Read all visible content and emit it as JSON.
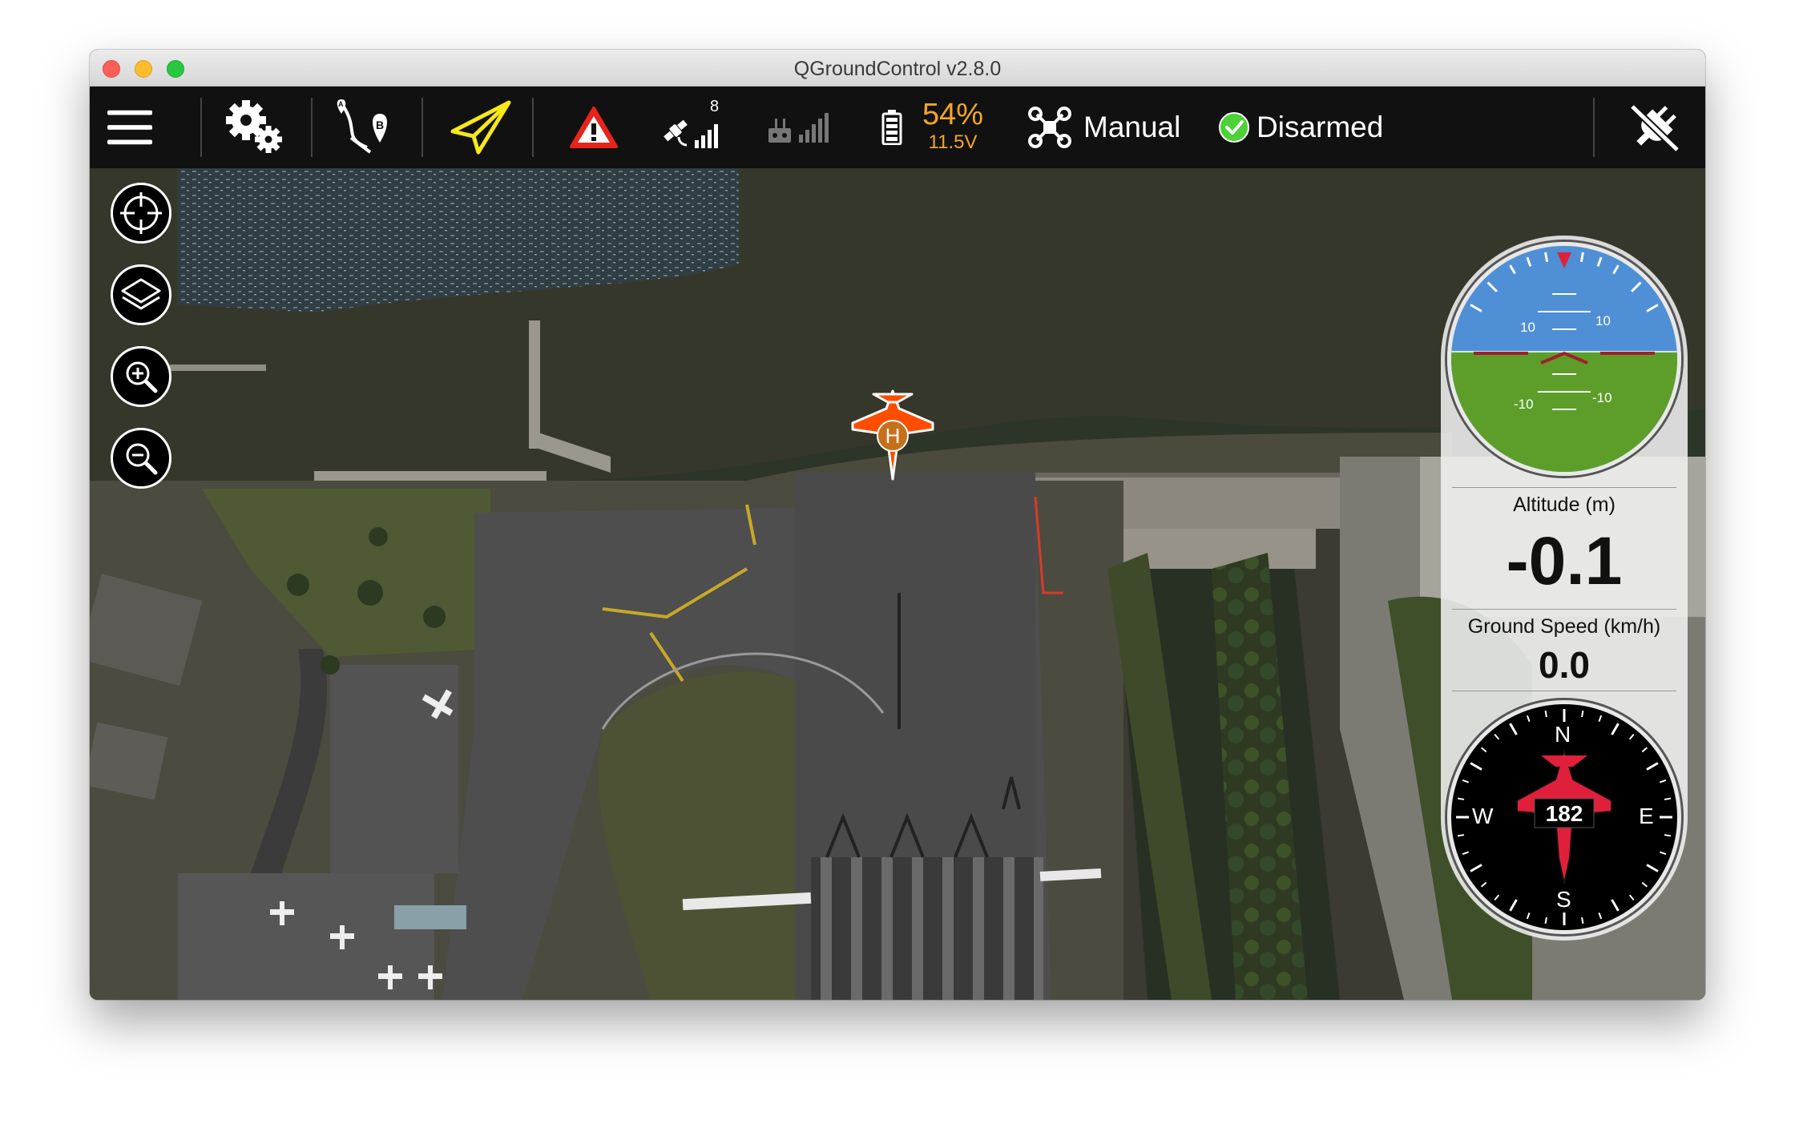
{
  "window": {
    "title": "QGroundControl v2.8.0"
  },
  "toolbar": {
    "satellite_count": "8",
    "battery_percent": "54%",
    "battery_voltage": "11.5V",
    "flight_mode": "Manual",
    "arm_status": "Disarmed"
  },
  "colors": {
    "battery": "#f5a623",
    "vehicle": "#ff4d00",
    "plan_yellow": "#f7e81b",
    "warning_red": "#e8231c",
    "armed_green": "#4cd137"
  },
  "instruments": {
    "altitude_label": "Altitude (m)",
    "altitude_value": "-0.1",
    "speed_label": "Ground Speed (km/h)",
    "speed_value": "0.0",
    "heading_value": "182",
    "compass_n": "N",
    "compass_e": "E",
    "compass_s": "S",
    "compass_w": "W",
    "pitch_up_left": "10",
    "pitch_up_right": "10",
    "pitch_down_left": "-10",
    "pitch_down_right": "-10"
  },
  "map": {
    "home_label": "H"
  },
  "icons": {
    "menu": "menu-icon",
    "settings": "gear-icon",
    "plan": "route-ab-icon",
    "fly": "paper-plane-icon",
    "warning": "warning-icon",
    "gps": "satellite-icon",
    "rc": "rc-signal-icon",
    "battery": "battery-icon",
    "mode": "quadcopter-icon",
    "armed": "check-circle-icon",
    "disconnect": "plug-disconnect-icon",
    "center": "crosshair-icon",
    "layers": "layers-icon",
    "zoom_in": "zoom-in-icon",
    "zoom_out": "zoom-out-icon"
  }
}
